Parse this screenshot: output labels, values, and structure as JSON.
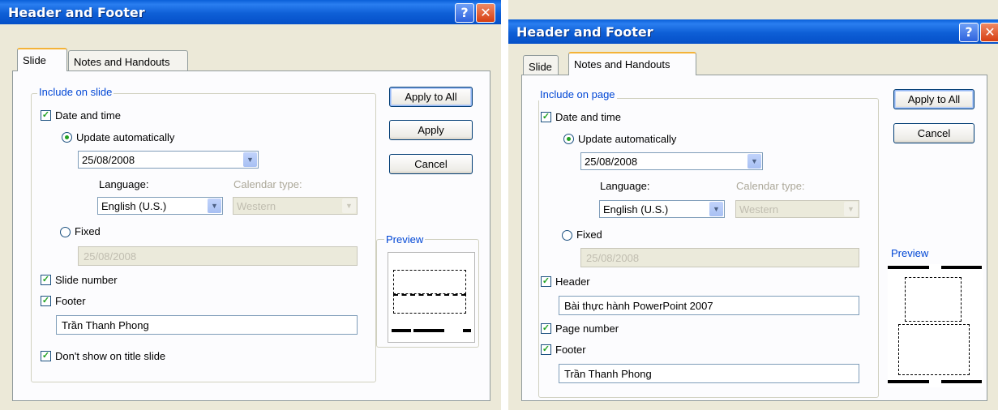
{
  "left": {
    "title": "Header and Footer",
    "help_glyph": "?",
    "close_glyph": "✕",
    "tabs": [
      "Slide",
      "Notes and Handouts"
    ],
    "group_label": "Include on slide",
    "date_time_label": "Date and time",
    "update_auto_label": "Update automatically",
    "date_value": "25/08/2008",
    "language_label": "Language:",
    "calendar_label": "Calendar type:",
    "language_value": "English (U.S.)",
    "calendar_value": "Western",
    "fixed_label": "Fixed",
    "fixed_value": "25/08/2008",
    "slide_number_label": "Slide number",
    "footer_label": "Footer",
    "footer_value": "Trần Thanh Phong",
    "dont_show_label": "Don't show on title slide",
    "apply_all": "Apply to All",
    "apply": "Apply",
    "cancel": "Cancel",
    "preview_label": "Preview"
  },
  "right": {
    "title": "Header and Footer",
    "help_glyph": "?",
    "close_glyph": "✕",
    "tabs": [
      "Slide",
      "Notes and Handouts"
    ],
    "group_label": "Include on page",
    "date_time_label": "Date and time",
    "update_auto_label": "Update automatically",
    "date_value": "25/08/2008",
    "language_label": "Language:",
    "calendar_label": "Calendar type:",
    "language_value": "English (U.S.)",
    "calendar_value": "Western",
    "fixed_label": "Fixed",
    "fixed_value": "25/08/2008",
    "header_label": "Header",
    "header_value": "Bài thực hành PowerPoint 2007",
    "page_number_label": "Page number",
    "footer_label": "Footer",
    "footer_value": "Trần Thanh Phong",
    "apply_all": "Apply to All",
    "cancel": "Cancel",
    "preview_label": "Preview"
  },
  "check_glyph": "✓",
  "arrow_glyph": "▼",
  "colors": {
    "title_bar": "#0a5fd8",
    "accent_label": "#0046d5",
    "check": "#21a121",
    "dialog_bg": "#ece9d8"
  }
}
